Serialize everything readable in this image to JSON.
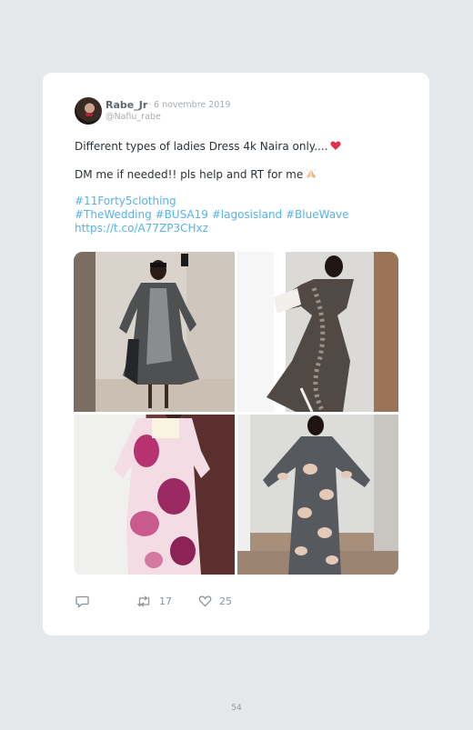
{
  "tweet": {
    "author_name": "Rabe_Jr",
    "date": "· 6 novembre 2019",
    "handle": "@Nafiu_rabe",
    "line1": "Different types of ladies Dress 4k Naira only....",
    "line2": "DM me if needed!! pls help and RT for me",
    "hashtags_line1": "#11Forty5clothing",
    "hashtags_line2": "#TheWedding #BUSA19 #lagosisland #BlueWave",
    "short_link": "https://t.co/A77ZP3CHxz",
    "emoji_1": "heart-emoji",
    "emoji_2": "praying-hands-emoji"
  },
  "media": [
    {
      "icon": "photo-woman-grey-satin-dress"
    },
    {
      "icon": "photo-woman-floral-dress"
    },
    {
      "icon": "photo-woman-pink-floral-dress"
    },
    {
      "icon": "photo-woman-grey-floral-kaftan"
    }
  ],
  "actions": {
    "reply_icon": "reply-icon",
    "retweet_icon": "retweet-icon",
    "retweet_count": "17",
    "like_icon": "heart-icon",
    "like_count": "25"
  },
  "footer": {
    "page_number": "54"
  },
  "colors": {
    "background": "#e5e8ea",
    "card": "#ffffff",
    "link": "#56b2e8",
    "text": "#2a3237",
    "muted": "#a5adb3"
  }
}
